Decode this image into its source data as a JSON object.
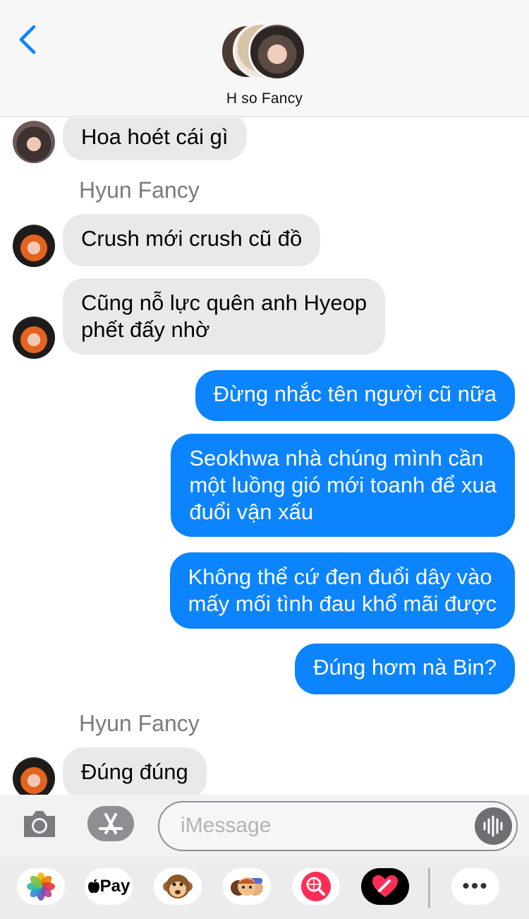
{
  "header": {
    "back_icon": "chevron-left-icon",
    "group_name": "H so Fancy",
    "accent": "#0b84fe"
  },
  "messages": [
    {
      "direction": "incoming",
      "avatar": "avatar-1",
      "lines": [
        "Hoa hoét cái gì"
      ]
    },
    {
      "direction": "sender-label",
      "text": "Hyun Fancy"
    },
    {
      "direction": "incoming",
      "avatar": "avatar-2",
      "lines": [
        "Crush mới crush cũ đồ"
      ]
    },
    {
      "direction": "incoming",
      "avatar": "avatar-2",
      "lines": [
        "Cũng nỗ lực quên anh Hyeop",
        "phết đấy nhờ"
      ]
    },
    {
      "direction": "outgoing",
      "lines": [
        "Đừng nhắc tên người cũ nữa"
      ]
    },
    {
      "direction": "outgoing",
      "lines": [
        "Seokhwa nhà chúng mình cần",
        "một luồng gió mới toanh để xua",
        "đuổi vận xấu"
      ]
    },
    {
      "direction": "outgoing",
      "lines": [
        "Không thể cứ đen đuổi dây vào",
        "mấy mối tình đau khổ mãi được"
      ]
    },
    {
      "direction": "outgoing",
      "lines": [
        "Đúng hơm nà Bin?"
      ]
    },
    {
      "direction": "sender-label",
      "text": "Hyun Fancy"
    },
    {
      "direction": "incoming",
      "avatar": "avatar-2",
      "lines": [
        "Đúng đúng"
      ]
    }
  ],
  "input": {
    "placeholder": "iMessage",
    "camera_icon": "camera-icon",
    "apps_icon": "app-store-icon",
    "voice_icon": "audio-waveform-icon"
  },
  "app_strip": {
    "items": [
      "photos-icon",
      "apple-pay-icon",
      "monkey-animoji-icon",
      "memoji-stickers-icon",
      "web-search-icon",
      "digital-touch-icon",
      "more-icon"
    ],
    "apple_pay_label": "Pay",
    "more_label": "•••"
  },
  "colors": {
    "outgoing_bubble": "#0b84fe",
    "incoming_bubble": "#e9e9eb",
    "sender_label": "#7a7a7f"
  }
}
